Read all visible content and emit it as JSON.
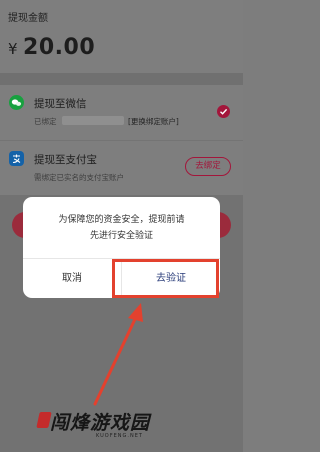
{
  "amount": {
    "label": "提现金额",
    "currency": "¥",
    "value": "20.00"
  },
  "methods": {
    "wechat": {
      "title": "提现至微信",
      "bound_prefix": "已绑定",
      "change_link": "[更换绑定账户]",
      "icon": "wechat-icon"
    },
    "alipay": {
      "title": "提现至支付宝",
      "subtitle": "需绑定已实名的支付宝账户",
      "unbind_label": "去绑定",
      "icon": "alipay-icon"
    }
  },
  "dialog": {
    "message_line1": "为保障您的资金安全，提现前请",
    "message_line2": "先进行安全验证",
    "cancel_label": "取消",
    "verify_label": "去验证"
  },
  "watermark": {
    "text": "闯烽游戏园",
    "url": "KUOFENG.NET"
  },
  "colors": {
    "accent": "#a3163b",
    "highlight": "#e3412e",
    "wechat": "#17a13f",
    "alipay": "#1462a8"
  }
}
